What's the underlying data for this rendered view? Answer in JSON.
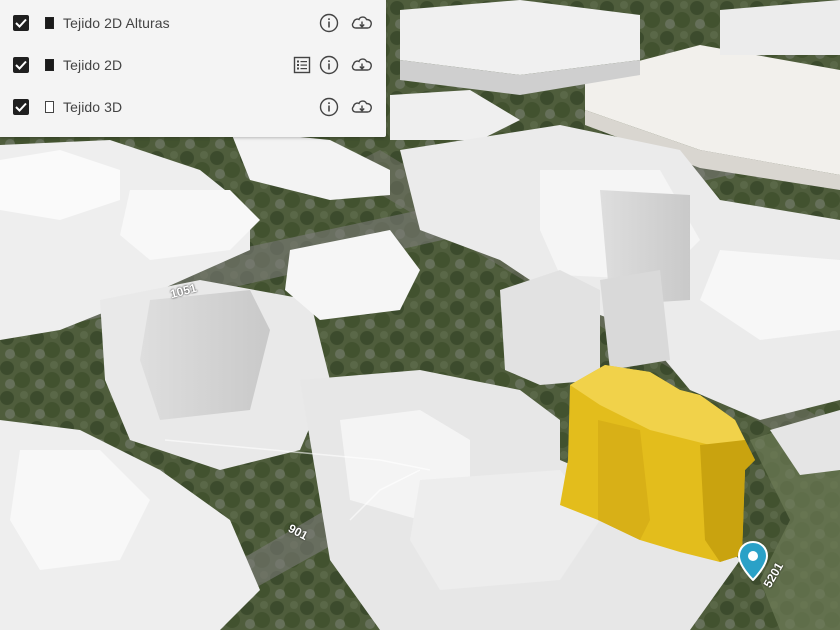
{
  "layers_panel": {
    "items": [
      {
        "label": "Tejido 2D Alturas",
        "checked": true,
        "swatch": "filled",
        "icons": [
          "info-icon",
          "download-cloud-icon"
        ]
      },
      {
        "label": "Tejido 2D",
        "checked": true,
        "swatch": "filled",
        "icons": [
          "legend-list-icon",
          "info-icon",
          "download-cloud-icon"
        ]
      },
      {
        "label": "Tejido 3D",
        "checked": true,
        "swatch": "empty",
        "icons": [
          "info-icon",
          "download-cloud-icon"
        ]
      }
    ]
  },
  "map": {
    "street_labels": [
      "5201",
      "901",
      "1051"
    ],
    "highlight_color": "#e3bd1c",
    "marker_color": "#2aa1c7"
  }
}
